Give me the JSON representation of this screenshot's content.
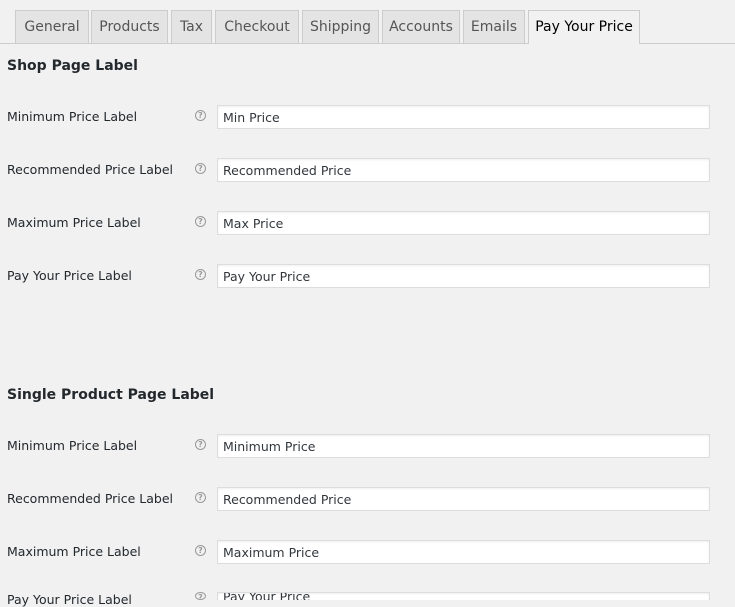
{
  "tabs": [
    {
      "label": "General",
      "active": false
    },
    {
      "label": "Products",
      "active": false
    },
    {
      "label": "Tax",
      "active": false
    },
    {
      "label": "Checkout",
      "active": false
    },
    {
      "label": "Shipping",
      "active": false
    },
    {
      "label": "Accounts",
      "active": false
    },
    {
      "label": "Emails",
      "active": false
    },
    {
      "label": "Pay Your Price",
      "active": true
    }
  ],
  "shop_section": {
    "title": "Shop Page Label",
    "rows": [
      {
        "label": "Minimum Price Label",
        "value": "Min Price",
        "help_icon": "question-circle-icon"
      },
      {
        "label": "Recommended Price Label",
        "value": "Recommended Price",
        "help_icon": "question-circle-icon"
      },
      {
        "label": "Maximum Price Label",
        "value": "Max Price",
        "help_icon": "question-circle-icon"
      },
      {
        "label": "Pay Your Price Label",
        "value": "Pay Your Price",
        "help_icon": "question-circle-icon"
      }
    ]
  },
  "single_section": {
    "title": "Single Product Page Label",
    "rows": [
      {
        "label": "Minimum Price Label",
        "value": "Minimum Price",
        "help_icon": "question-circle-icon"
      },
      {
        "label": "Recommended Price Label",
        "value": "Recommended Price",
        "help_icon": "question-circle-icon"
      },
      {
        "label": "Maximum Price Label",
        "value": "Maximum Price",
        "help_icon": "question-circle-icon"
      },
      {
        "label": "Pay Your Price Label",
        "value": "Pay Your Price",
        "help_icon": "question-circle-icon"
      }
    ]
  },
  "help_glyph": "?"
}
